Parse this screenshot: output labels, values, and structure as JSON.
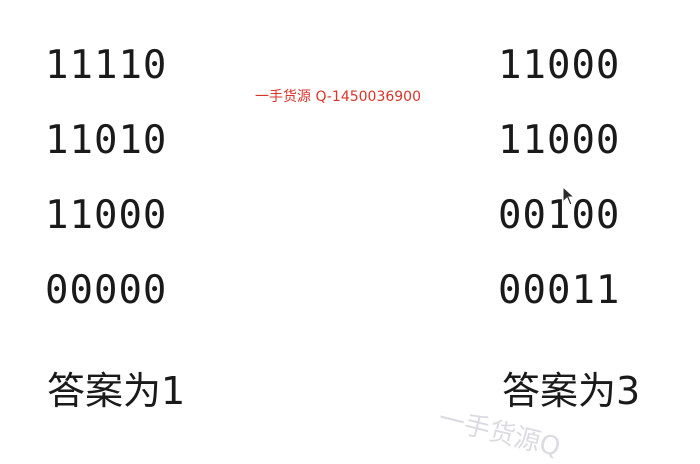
{
  "left_grid": {
    "rows": [
      "11110",
      "11010",
      "11000",
      "00000"
    ],
    "answer": "答案为1"
  },
  "right_grid": {
    "rows": [
      "11000",
      "11000",
      "00100",
      "00011"
    ],
    "answer": "答案为3"
  },
  "watermark": {
    "top_text": "一手货源 Q-1450036900",
    "diagonal_text": "一手货源Q"
  },
  "colors": {
    "text": "#1a1a1a",
    "watermark_red": "#d9342b"
  },
  "icons": {
    "cursor": "mouse-pointer-icon"
  }
}
